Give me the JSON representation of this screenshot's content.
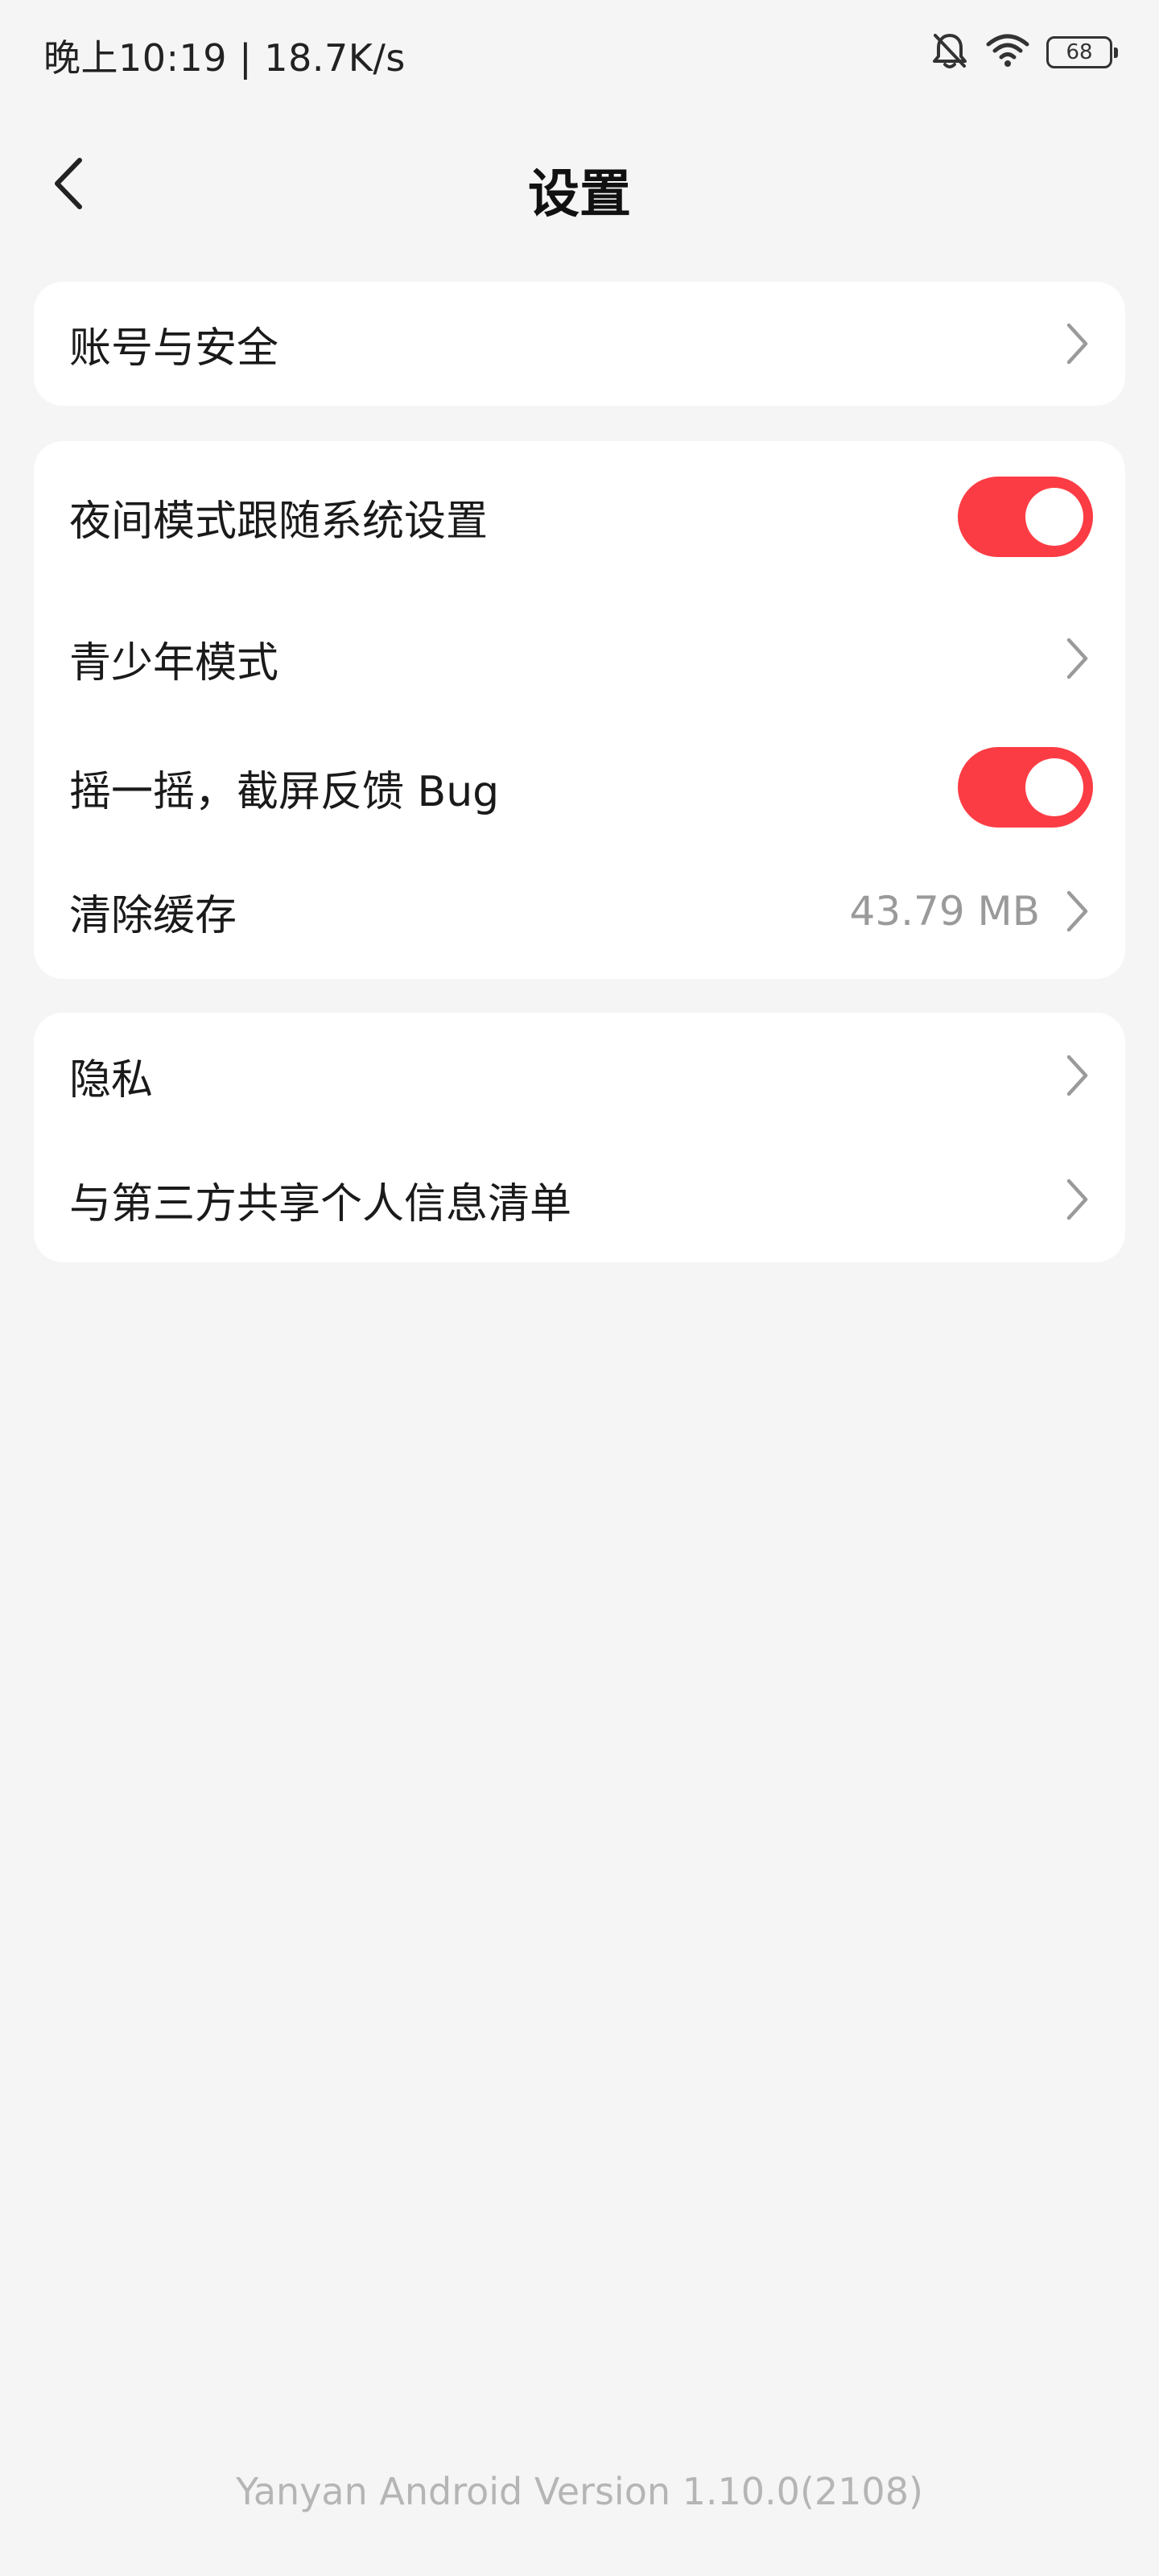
{
  "status_bar": {
    "time_speed": "晚上10:19 | 18.7K/s",
    "battery": "68",
    "icons": [
      "bell-muted-icon",
      "wifi-icon",
      "battery-icon"
    ]
  },
  "header": {
    "title": "设置",
    "back_icon": "back-arrow-icon"
  },
  "account_card": {
    "items": [
      {
        "label": "账号与安全"
      }
    ]
  },
  "general_card": {
    "items": [
      {
        "label": "夜间模式跟随系统设置",
        "toggle_on": true
      },
      {
        "label": "青少年模式"
      },
      {
        "label": "摇一摇，截屏反馈 Bug",
        "toggle_on": true
      },
      {
        "label": "清除缓存",
        "value": "43.79 MB"
      }
    ]
  },
  "privacy_card": {
    "items": [
      {
        "label": "隐私"
      },
      {
        "label": "与第三方共享个人信息清单"
      }
    ]
  },
  "footer": {
    "version": "Yanyan Android Version 1.10.0(2108)"
  },
  "colors": {
    "accent": "#fc3c44",
    "background": "#f5f5f5",
    "card": "#ffffff",
    "secondary_text": "#9a9a9a"
  }
}
